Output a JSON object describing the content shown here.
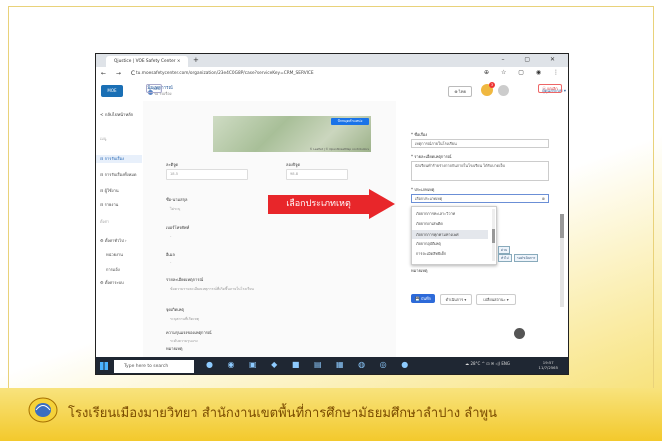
{
  "browser": {
    "tab_title": "Qjustice | VOE Safety Center ×",
    "url": "tu.moesafetycenter.com/organization/23e4C0G8P/case?serviceKey=CRM_SERVICE",
    "window_controls": "– ▢ ✕",
    "nav_buttons": "← → C",
    "url_icons": "⊕ ☆ ▢ ◉ ⋮"
  },
  "app": {
    "logo_text": "MOE",
    "org_name": "เพิ่มเหตุการณ์",
    "org_sub": "รอ รับเรื่อง",
    "back_button": "< กลับ",
    "lang_button": "⊕ ไทย",
    "notif_count": "3",
    "user_name": "ผู้ดูแลระบบ ▾",
    "close_button": "ⓧ ยกเลิก"
  },
  "sidebar": {
    "header": "< กลับไปหน้าหลัก",
    "section1": "เมนู",
    "items": [
      {
        "label": "⊟ การรับเรื่อง"
      },
      {
        "label": "⊟ การรับเรื่องทั้งหมด"
      },
      {
        "label": "⊟ ผู้ใช้งาน"
      },
      {
        "label": "⊟ รายงาน"
      }
    ],
    "section2": "ตั้งค่า",
    "sub_items": [
      {
        "label": "⚙ ตั้งค่าทั่วไป ›"
      },
      {
        "label": "หน่วยงาน"
      },
      {
        "label": "การแจ้ง"
      },
      {
        "label": "⚙ ตั้งค่าระบบ"
      }
    ]
  },
  "map": {
    "button": "ปักหมุดตำแหน่ง",
    "credit": "© Leaflet | © OpenStreetMap contributors"
  },
  "form": {
    "fields": [
      {
        "label": "ละติจูด",
        "value": "18.5"
      },
      {
        "label": "ลองจิจูด",
        "value": "98.8"
      },
      {
        "label": "ชื่อ-นามสกุล",
        "value": "ไม่ระบุ"
      },
      {
        "label": "เบอร์โทรศัพท์",
        "value": "-"
      },
      {
        "label": "อีเมล",
        "value": "-"
      },
      {
        "label": "รายละเอียดเหตุการณ์",
        "value": "ข้อความรายละเอียดเหตุการณ์ที่เกิดขึ้นภายในโรงเรียน"
      },
      {
        "label": "จุดเกิดเหตุ",
        "value": "ระบุสถานที่เกิดเหตุ"
      },
      {
        "label": "ความรุนแรงของเหตุการณ์",
        "value": "ระดับความรุนแรง"
      },
      {
        "label": "หมายเหตุ",
        "value": "-"
      }
    ]
  },
  "panel": {
    "title_label": "* ชื่อเรื่อง",
    "title_value": "เหตุการณ์ภายในโรงเรียน",
    "detail_label": "* รายละเอียดเหตุการณ์",
    "detail_value": "นักเรียนทำร้ายร่างกายกันภายในโรงเรียน ได้รับบาดเจ็บ",
    "type_label": "* ประเภทเหตุ",
    "type_placeholder": "เลือกประเภทเหตุ",
    "dropdown_options": [
      {
        "label": "ภัยจากการทะเลาะวิวาท"
      },
      {
        "label": "ภัยจากยาเสพติด"
      },
      {
        "label": "ภัยจากการคุกคามทางเพศ"
      },
      {
        "label": "ภัยจากอุบัติเหตุ"
      },
      {
        "label": "การละเมิดสิทธิเด็ก"
      }
    ],
    "tags": [
      "ด่วน",
      "ทั่วไป",
      "รอดำเนินการ"
    ],
    "note_label": "หมายเหตุ",
    "save_button": "💾 บันทึก",
    "btn2": "ดำเนินการ ▾",
    "btn3": "เปลี่ยนสถานะ ▾"
  },
  "callout": {
    "text": "เลือกประเภทเหตุ",
    "color": "#e8262a"
  },
  "taskbar": {
    "search_placeholder": "Type here to search",
    "tray": "☁ 28°C ^ ⊡ ✉ ◁) ENG",
    "clock_time": "19:57",
    "clock_date": "11/7/2565"
  },
  "footer": {
    "text": "โรงเรียนเมืองมายวิทยา สำนักงานเขตพื้นที่การศึกษามัธยมศึกษาลำปาง ลำพูน"
  }
}
